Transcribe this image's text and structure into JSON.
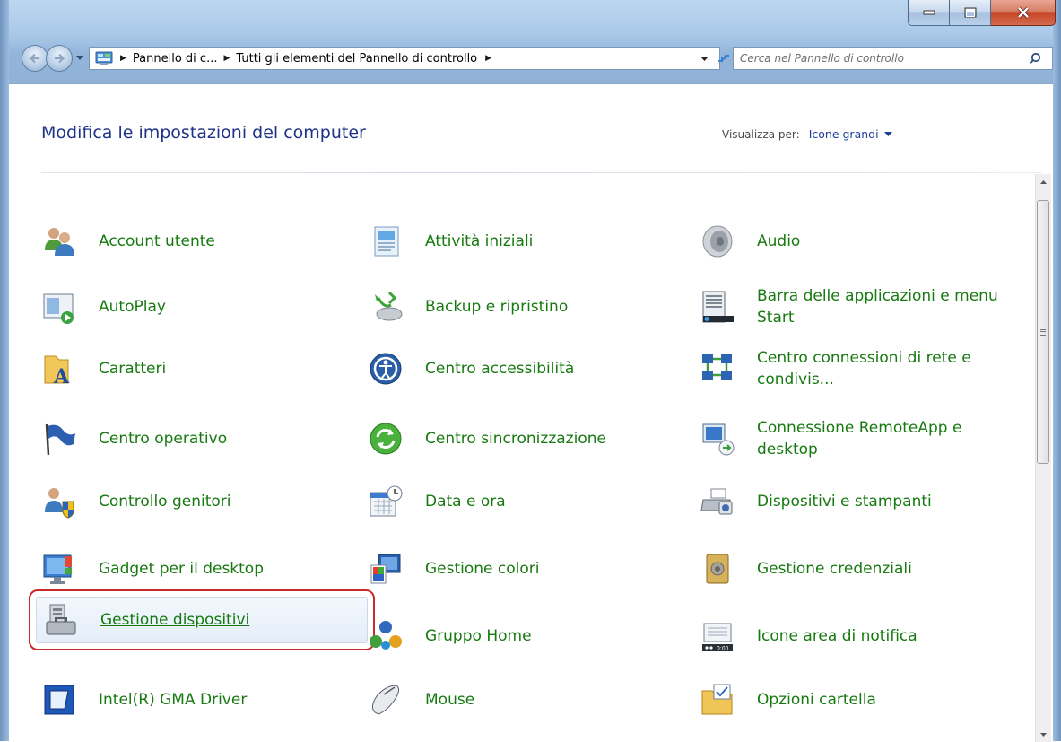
{
  "window": {
    "colors": {
      "frame": "#a9c8e8",
      "link": "#177a10",
      "heading": "#1e3287",
      "selection": "#c92a2a"
    }
  },
  "address": {
    "breadcrumbs": [
      "Pannello di c...",
      "Tutti gli elementi del Pannello di controllo"
    ]
  },
  "search": {
    "placeholder": "Cerca nel Pannello di controllo"
  },
  "header": {
    "title": "Modifica le impostazioni del computer",
    "view_by_label": "Visualizza per:",
    "view_by_value": "Icone grandi"
  },
  "items": [
    {
      "label": "Account utente",
      "icon": "users-icon"
    },
    {
      "label": "Attività iniziali",
      "icon": "getting-started-icon"
    },
    {
      "label": "Audio",
      "icon": "speaker-icon"
    },
    {
      "label": "AutoPlay",
      "icon": "autoplay-icon"
    },
    {
      "label": "Backup e ripristino",
      "icon": "backup-icon"
    },
    {
      "label": "Barra delle applicazioni e menu Start",
      "icon": "taskbar-icon"
    },
    {
      "label": "Caratteri",
      "icon": "fonts-folder-icon"
    },
    {
      "label": "Centro accessibilità",
      "icon": "accessibility-icon"
    },
    {
      "label": "Centro connessioni di rete e condivis...",
      "icon": "network-icon"
    },
    {
      "label": "Centro operativo",
      "icon": "action-center-flag-icon"
    },
    {
      "label": "Centro sincronizzazione",
      "icon": "sync-icon"
    },
    {
      "label": "Connessione RemoteApp e desktop",
      "icon": "remoteapp-icon"
    },
    {
      "label": "Controllo genitori",
      "icon": "parental-controls-icon"
    },
    {
      "label": "Data e ora",
      "icon": "calendar-clock-icon"
    },
    {
      "label": "Dispositivi e stampanti",
      "icon": "printer-icon"
    },
    {
      "label": "Gadget per il desktop",
      "icon": "gadgets-icon"
    },
    {
      "label": "Gestione colori",
      "icon": "color-management-icon"
    },
    {
      "label": "Gestione credenziali",
      "icon": "credential-vault-icon"
    },
    {
      "label": "Gestione dispositivi",
      "icon": "device-manager-icon",
      "selected": true
    },
    {
      "label": "Gruppo Home",
      "icon": "homegroup-icon"
    },
    {
      "label": "Icone area di notifica",
      "icon": "notification-area-icon"
    },
    {
      "label": "Intel(R) GMA Driver",
      "icon": "intel-gma-icon"
    },
    {
      "label": "Mouse",
      "icon": "mouse-icon"
    },
    {
      "label": "Opzioni cartella",
      "icon": "folder-options-icon"
    }
  ]
}
